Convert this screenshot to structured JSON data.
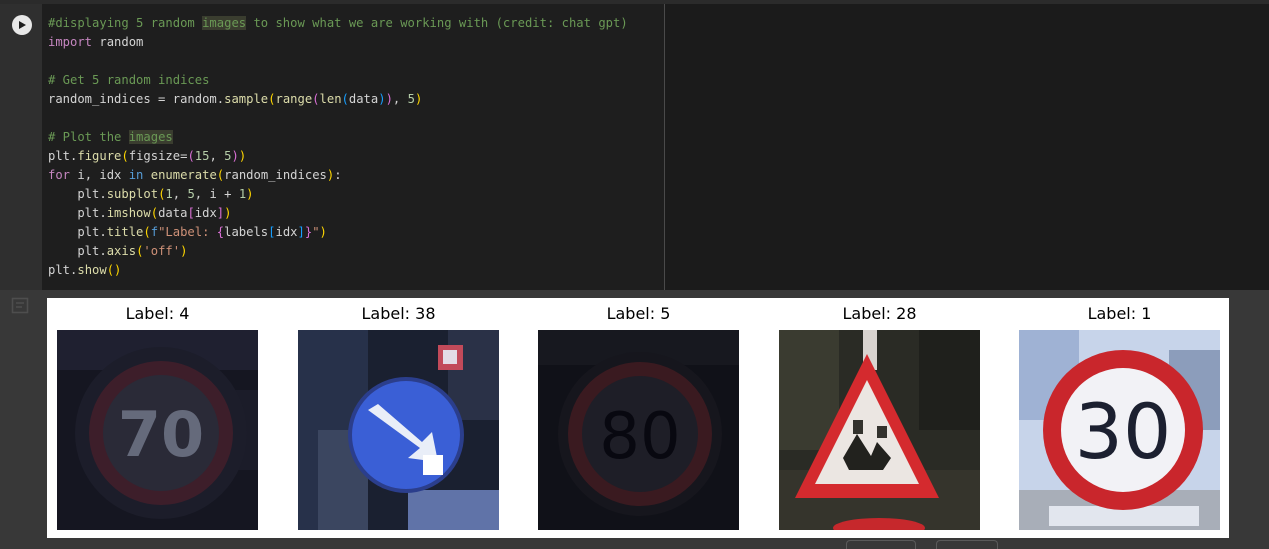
{
  "cell": {
    "run_icon": "play-icon",
    "code": [
      "#displaying 5 random images to show what we are working with (credit: chat gpt)",
      "import random",
      "",
      "# Get 5 random indices",
      "random_indices = random.sample(range(len(data)), 5)",
      "",
      "# Plot the images",
      "plt.figure(figsize=(15, 5))",
      "for i, idx in enumerate(random_indices):",
      "    plt.subplot(1, 5, i + 1)",
      "    plt.imshow(data[idx])",
      "    plt.title(f\"Label: {labels[idx]}\")",
      "    plt.axis('off')",
      "plt.show()"
    ]
  },
  "output": {
    "icon": "output-toggle-icon",
    "panels": [
      {
        "title": "Label: 4",
        "sign": "speed-limit-70"
      },
      {
        "title": "Label: 38",
        "sign": "keep-right"
      },
      {
        "title": "Label: 5",
        "sign": "speed-limit-80"
      },
      {
        "title": "Label: 28",
        "sign": "children-crossing"
      },
      {
        "title": "Label: 1",
        "sign": "speed-limit-30"
      }
    ]
  },
  "sign_text": {
    "p0": "70",
    "p2": "80",
    "p4": "30"
  },
  "colors": {
    "sign_red": "#c4232b",
    "background": "#383838",
    "editor": "#1e1e1e"
  }
}
